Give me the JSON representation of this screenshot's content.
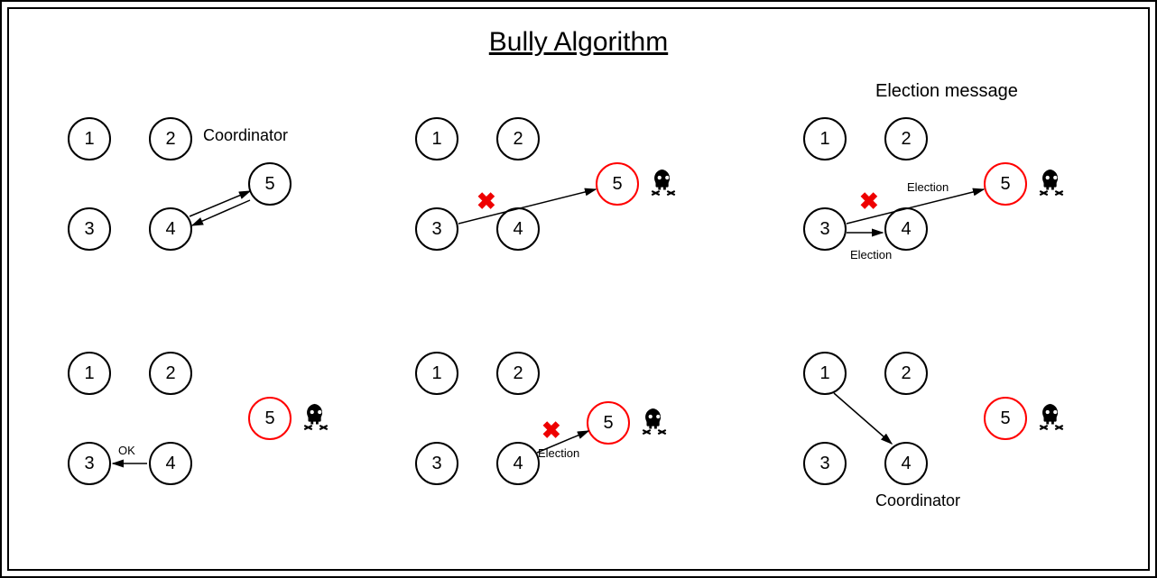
{
  "title": "Bully Algorithm",
  "labels": {
    "coordinator": "Coordinator",
    "election_msg_header": "Election message",
    "election": "Election",
    "ok": "OK",
    "cross": "✖"
  },
  "nodes": [
    "1",
    "2",
    "3",
    "4",
    "5"
  ]
}
